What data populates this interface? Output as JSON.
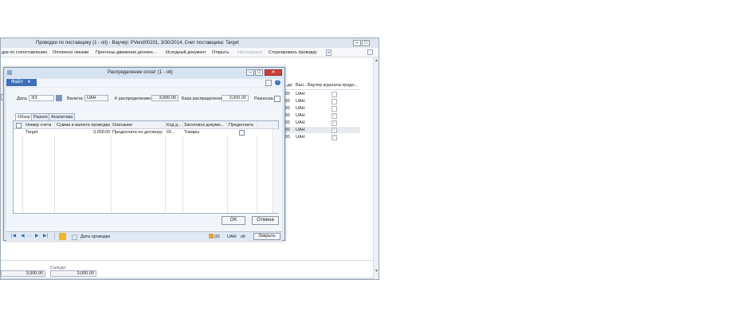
{
  "main_window": {
    "title": "Проводки по поставщику (1 - oit) - Ваучер: PVend00201, 3/30/2014, Счет поставщика: Target",
    "menu": [
      "дки по сопоставлению",
      "Оплачено чеками",
      "Прогнозы движения денежн...",
      "Исходный документ",
      "Открыть",
      "Наследовал",
      "Сторнировать проводку"
    ],
    "columns": [
      "...до",
      "Вал...",
      "Ваучер журнала предо..."
    ],
    "rows": [
      {
        "amount": ".00",
        "currency": "UAH",
        "checked": false
      },
      {
        "amount": ".00",
        "currency": "UAH",
        "checked": false
      },
      {
        "amount": ".00",
        "currency": "UAH",
        "checked": false
      },
      {
        "amount": ".00",
        "currency": "UAH",
        "checked": true
      },
      {
        "amount": ".00",
        "currency": "UAH",
        "checked": true
      },
      {
        "amount": ".00",
        "currency": "UAH",
        "checked": true,
        "selected": true
      },
      {
        "amount": ".00",
        "currency": "UAH",
        "checked": true
      }
    ],
    "balance_label": "Сальдо",
    "totals": [
      "3,000.00",
      "3,000.00"
    ]
  },
  "dialog": {
    "title": "Распределение оплат (1 - oit)",
    "file_label": "Файл",
    "date_label": "Дата:",
    "date_value": "3/3",
    "currency_label": "Валюта:",
    "currency_value": "UAH",
    "to_distribute_label": "К распределению:",
    "to_distribute_value": "3,000.00",
    "base_label": "База распределения:",
    "base_value": "3,000.00",
    "spread_label": "Разноска:",
    "tabs": [
      "Обзор",
      "Разное",
      "Аналитика"
    ],
    "columns": [
      "Номер счета",
      "Сумма в валюте проводки",
      "Описание",
      "Код д...",
      "Заголовок докуме...",
      "Предоплата"
    ],
    "row": {
      "account": "Target",
      "amount": "3,000.00",
      "description": "Предоплата по договору",
      "code": "OI...",
      "doc_header": "Товары"
    },
    "ok_label": "OK",
    "cancel_label": "Отмена",
    "status_date_label": "Дата проводки",
    "status_currency": "UAH",
    "status_company": "oit",
    "status_counter": "(0)",
    "close_label": "Закрыть"
  }
}
